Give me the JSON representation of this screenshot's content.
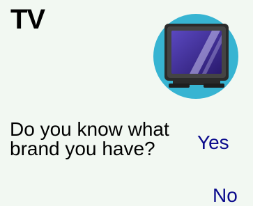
{
  "screen": {
    "title": "TV",
    "icon": "tv-icon",
    "question": "Do you know what brand you have?",
    "answers": {
      "yes": "Yes",
      "no": "No"
    }
  },
  "colors": {
    "background": "#f2f8f2",
    "answer_text": "#0a0a8c",
    "icon_circle": "#37b4d2",
    "screen_fill": "#3c2a8a"
  }
}
